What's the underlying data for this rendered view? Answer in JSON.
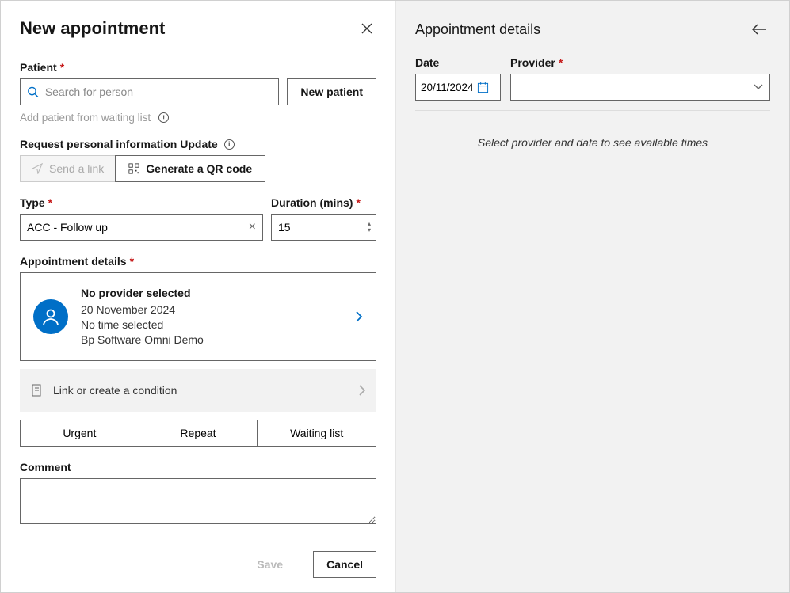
{
  "left": {
    "title": "New appointment",
    "patient": {
      "label": "Patient",
      "placeholder": "Search for person",
      "new_button": "New patient",
      "waiting_link": "Add patient from waiting list"
    },
    "rpi": {
      "label": "Request personal information Update",
      "send_link": "Send a link",
      "qr": "Generate a QR code"
    },
    "type": {
      "label": "Type",
      "value": "ACC - Follow up"
    },
    "duration": {
      "label": "Duration (mins)",
      "value": "15"
    },
    "details": {
      "label": "Appointment details",
      "line1": "No provider selected",
      "line2": "20 November 2024",
      "line3": "No time selected",
      "line4": "Bp Software Omni Demo"
    },
    "condition_link": "Link or create a condition",
    "segments": {
      "urgent": "Urgent",
      "repeat": "Repeat",
      "waiting": "Waiting list"
    },
    "comment_label": "Comment",
    "save": "Save",
    "cancel": "Cancel"
  },
  "right": {
    "title": "Appointment details",
    "date_label": "Date",
    "date_value": "20/11/2024",
    "provider_label": "Provider",
    "empty": "Select provider and date to see available times"
  }
}
